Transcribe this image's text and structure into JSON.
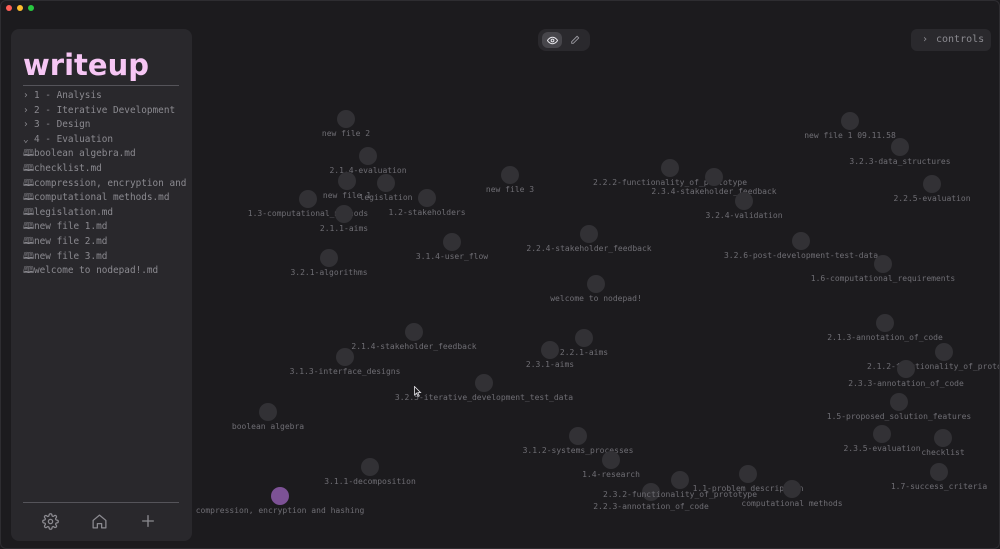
{
  "sidebar": {
    "logo": "writeup",
    "items": [
      {
        "icon": "chevron-right-icon",
        "glyph": "›",
        "label": "1 - Analysis"
      },
      {
        "icon": "chevron-right-icon",
        "glyph": "›",
        "label": "2 - Iterative Development"
      },
      {
        "icon": "chevron-right-icon",
        "glyph": "›",
        "label": "3 - Design"
      },
      {
        "icon": "chevron-down-icon",
        "glyph": "⌄",
        "label": "4 - Evaluation"
      },
      {
        "icon": "book-icon",
        "glyph": "🕮",
        "label": "boolean algebra.md"
      },
      {
        "icon": "book-icon",
        "glyph": "🕮",
        "label": "checklist.md"
      },
      {
        "icon": "book-icon",
        "glyph": "🕮",
        "label": "compression, encryption and hashing.md"
      },
      {
        "icon": "book-icon",
        "glyph": "🕮",
        "label": "computational methods.md"
      },
      {
        "icon": "book-icon",
        "glyph": "🕮",
        "label": "legislation.md"
      },
      {
        "icon": "book-icon",
        "glyph": "🕮",
        "label": "new file 1.md"
      },
      {
        "icon": "book-icon",
        "glyph": "🕮",
        "label": "new file 2.md"
      },
      {
        "icon": "book-icon",
        "glyph": "🕮",
        "label": "new file 3.md"
      },
      {
        "icon": "book-icon",
        "glyph": "🕮",
        "label": "welcome to nodepad!.md"
      }
    ],
    "footer_icons": [
      "settings-icon",
      "home-icon",
      "plus-icon"
    ]
  },
  "toolbar": {
    "view_icon": "eye-icon",
    "edit_icon": "pencil-icon",
    "controls_label": "controls",
    "controls_glyph": "›"
  },
  "colors": {
    "logo": "#f6c6f4",
    "active_node": "#7d5296",
    "node": "#323135",
    "background": "#1c1b1e"
  },
  "graph": {
    "active_node": "compression, encryption and hashing",
    "nodes": [
      {
        "label": "new file 2"
      },
      {
        "label": "2.1.4-evaluation"
      },
      {
        "label": "new file 1"
      },
      {
        "label": "legislation"
      },
      {
        "label": "1.2-stakeholders"
      },
      {
        "label": "1.3-computational_methods"
      },
      {
        "label": "2.1.1-aims"
      },
      {
        "label": "new file 3"
      },
      {
        "label": "3.2.1-algorithms"
      },
      {
        "label": "3.1.4-user_flow"
      },
      {
        "label": "2.2.4-stakeholder_feedback"
      },
      {
        "label": "2.2.2-functionality_of_prototype"
      },
      {
        "label": "2.3.4-stakeholder_feedback"
      },
      {
        "label": "3.2.4-validation"
      },
      {
        "label": "new file 1 09.11.58"
      },
      {
        "label": "3.2.3-data_structures"
      },
      {
        "label": "2.2.5-evaluation"
      },
      {
        "label": "3.2.6-post-development-test-data"
      },
      {
        "label": "1.6-computational_requirements"
      },
      {
        "label": "welcome to nodepad!"
      },
      {
        "label": "2.1.4-stakeholder_feedback"
      },
      {
        "label": "3.1.3-interface_designs"
      },
      {
        "label": "2.2.1-aims"
      },
      {
        "label": "2.3.1-aims"
      },
      {
        "label": "3.2.5-iterative_development_test_data"
      },
      {
        "label": "2.1.3-annotation_of_code"
      },
      {
        "label": "2.1.2-functionality_of_prototype"
      },
      {
        "label": "2.3.3-annotation_of_code"
      },
      {
        "label": "1.5-proposed_solution_features"
      },
      {
        "label": "boolean algebra"
      },
      {
        "label": "3.1.2-systems_processes"
      },
      {
        "label": "2.3.5-evaluation"
      },
      {
        "label": "checklist"
      },
      {
        "label": "1.4-research"
      },
      {
        "label": "3.1.1-decomposition"
      },
      {
        "label": "2.2.3-annotation_of_code"
      },
      {
        "label": "2.3.2-functionality_of_prototype"
      },
      {
        "label": "1.1-problem_description"
      },
      {
        "label": "computational methods"
      },
      {
        "label": "1.7-success_criteria"
      },
      {
        "label": "compression, encryption and hashing"
      }
    ]
  }
}
